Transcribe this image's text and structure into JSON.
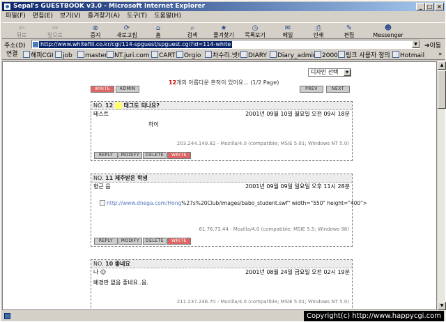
{
  "window": {
    "title": "Sepal's GUESTBOOK v3.0 - Microsoft Internet Explorer",
    "controls": {
      "minimize": "_",
      "maximize": "□",
      "close": "×"
    }
  },
  "menu": [
    "파일(F)",
    "편집(E)",
    "보기(V)",
    "즐겨찾기(A)",
    "도구(T)",
    "도움말(H)"
  ],
  "toolbar": {
    "back": "뒤로",
    "forward": "앞으로",
    "stop": "중지",
    "refresh": "새로고침",
    "home": "홈",
    "search": "검색",
    "favorites": "즐겨찾기",
    "history": "목록보기",
    "mail": "메일",
    "print": "인쇄",
    "edit": "편집",
    "messenger": "Messenger"
  },
  "address": {
    "label": "주소(D)",
    "url": "http://www.whitefill.co.kr/cgi/114-spguest/spguest.cgi?id=114-white",
    "go_label": "이동"
  },
  "links": {
    "label": "연결",
    "items": [
      "해피CGI",
      "job",
      "master",
      "NT.juri.com",
      "CART",
      "Orgio",
      "차수리.넷!",
      "DIARY",
      "Diary_admin",
      "2000",
      "링크 사용자 정의",
      "Hotmail"
    ],
    "more": "»"
  },
  "page": {
    "design_select": "디자인 선택",
    "count_text_pre": "개의 아름다운 흔적이 있어요... (",
    "count_number": "12",
    "count_pages": "1/2 Page",
    "count_text_post": ")",
    "buttons": {
      "write": "write",
      "admin": "admin",
      "prev": "prev",
      "next": "next"
    }
  },
  "entries": [
    {
      "no_label": "NO.",
      "no": "12",
      "subject_pre": "",
      "subject_highlight": "",
      "subject": "태그도 되나요?",
      "name": "테스트",
      "date": "2001년 09월 10일 월요일 오전 09시 18분",
      "body": "하이",
      "ua": "203.244.149.82 - Mozilla/4.0 (compatible; MSIE 5.01; Windows NT 5.0)"
    },
    {
      "no_label": "NO.",
      "no": "11",
      "subject": "제주받은 학생",
      "name": "형근 음",
      "date": "2001년 09월 09일 일요일 오후 11시 28분",
      "embed_link": "http://www.dnega.com/Hong",
      "embed_rest": "%27s%20Club/images/babo_student.swf\" width=\"550\" height=\"400\">",
      "ua": "61.76.73.44 - Mozilla/4.0 (compatible; MSIE 5.5; Windows 98)"
    },
    {
      "no_label": "NO.",
      "no": "10",
      "subject": "좋네요",
      "name": "나 ☺",
      "date": "2001년 08월 24일 금요일 오전 02시 19분",
      "body": "배경만 없음 좋네요..음.",
      "ua": "211.237.246.70 - Mozilla/4.0 (compatible; MSIE 5.01; Windows NT 5.0)"
    }
  ],
  "entry_buttons": {
    "reply": "reply",
    "modify": "modify",
    "delete": "delete",
    "write": "write"
  },
  "status": {
    "copyright": "Copyright(c) http://www.happycgi.com"
  }
}
